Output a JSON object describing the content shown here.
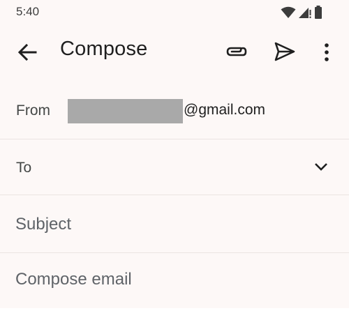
{
  "status_bar": {
    "time": "5:40",
    "icons": [
      "wifi-icon",
      "cellular-signal-icon",
      "battery-icon"
    ]
  },
  "app_bar": {
    "title": "Compose",
    "actions": [
      "back-arrow-icon",
      "attach-icon",
      "send-icon",
      "more-vert-icon"
    ]
  },
  "from": {
    "label": "From",
    "email_domain": "@gmail.com"
  },
  "to": {
    "label": "To",
    "value": ""
  },
  "subject": {
    "placeholder": "Subject",
    "value": ""
  },
  "body": {
    "placeholder": "Compose email",
    "value": ""
  },
  "colors": {
    "background": "#fdf8f7",
    "text_primary": "#1f1f1f",
    "text_secondary": "#444746",
    "divider": "#ebe4e2",
    "redaction": "#a9a9a9"
  }
}
